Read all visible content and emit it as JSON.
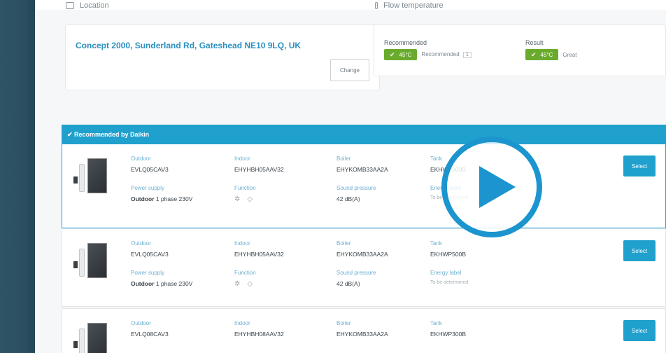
{
  "location": {
    "section_title": "Location",
    "address": "Concept 2000, Sunderland Rd, Gateshead NE10 9LQ, UK",
    "change_label": "Change"
  },
  "temperature": {
    "section_title": "Flow temperature",
    "recommended": {
      "label": "Recommended",
      "pill": "45°C",
      "note": "Recommended",
      "note_num": "1"
    },
    "result": {
      "label": "Result",
      "pill": "45°C",
      "note": "Great"
    }
  },
  "recommended_header": "✔ Recommended by Daikin",
  "units": [
    {
      "outdoor_label": "Outdoor",
      "outdoor": "EVLQ05CAV3",
      "indoor_label": "Indoor",
      "indoor": "EHYHBH05AAV32",
      "boiler_label": "Boiler",
      "boiler": "EHYKOMB33AA2A",
      "tank_label": "Tank",
      "tank": "EKHWP300B",
      "power_label": "Power supply",
      "power_strong": "Outdoor",
      "power_rest": " 1 phase 230V",
      "function_label": "Function",
      "sound_label": "Sound pressure",
      "sound": "42 dB(A)",
      "energy_label": "Energy label",
      "energy": "To be determined",
      "select_label": "Select"
    },
    {
      "outdoor_label": "Outdoor",
      "outdoor": "EVLQ05CAV3",
      "indoor_label": "Indoor",
      "indoor": "EHYHBH05AAV32",
      "boiler_label": "Boiler",
      "boiler": "EHYKOMB33AA2A",
      "tank_label": "Tank",
      "tank": "EKHWP500B",
      "power_label": "Power supply",
      "power_strong": "Outdoor",
      "power_rest": " 1 phase 230V",
      "function_label": "Function",
      "sound_label": "Sound pressure",
      "sound": "42 dB(A)",
      "energy_label": "Energy label",
      "energy": "To be determined",
      "select_label": "Select"
    },
    {
      "outdoor_label": "Outdoor",
      "outdoor": "EVLQ08CAV3",
      "indoor_label": "Indoor",
      "indoor": "EHYHBH08AAV32",
      "boiler_label": "Boiler",
      "boiler": "EHYKOMB33AA2A",
      "tank_label": "Tank",
      "tank": "EKHWP300B",
      "select_label": "Select"
    }
  ],
  "colors": {
    "accent": "#1fa0cd",
    "success": "#6aab2e",
    "sidebar": "#2b4f60",
    "link": "#2b8fc1"
  },
  "icons": {
    "heating": "snowflake-sun-icon",
    "water": "drop-icon",
    "play": "play-icon"
  }
}
